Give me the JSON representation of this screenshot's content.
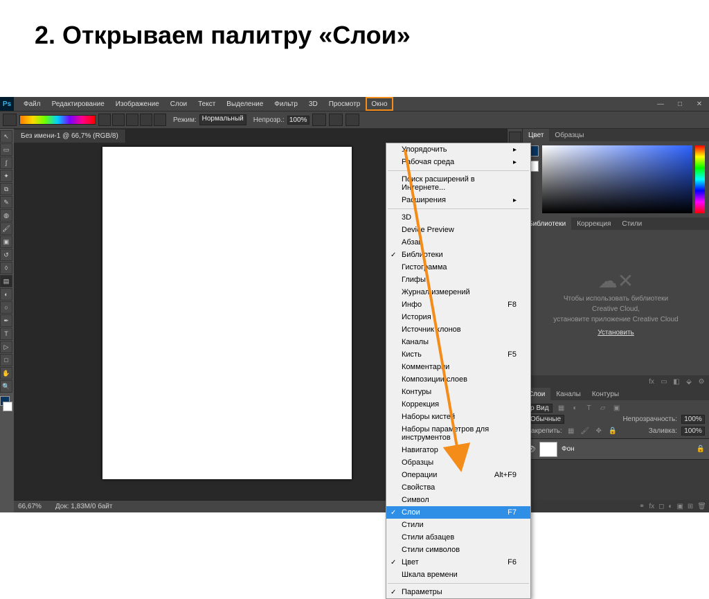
{
  "slide": {
    "title": "2. Открываем палитру «Слои»"
  },
  "menubar": {
    "logo": "Ps",
    "items": [
      "Файл",
      "Редактирование",
      "Изображение",
      "Слои",
      "Текст",
      "Выделение",
      "Фильтр",
      "3D",
      "Просмотр",
      "Окно"
    ]
  },
  "options": {
    "mode_label": "Режим:",
    "mode_value": "Нормальный",
    "opacity_label": "Непрозр.:",
    "opacity_value": "100%"
  },
  "doc_tab": "Без имени-1 @ 66,7% (RGB/8)",
  "status": {
    "zoom": "66,67%",
    "doc_info": "Док: 1,83M/0 байт"
  },
  "color_panel": {
    "tabs": [
      "Цвет",
      "Образцы"
    ]
  },
  "mid_tabs": [
    "Библиотеки",
    "Коррекция",
    "Стили"
  ],
  "cc": {
    "line1": "Чтобы использовать библиотеки",
    "line2": "Creative Cloud,",
    "line3": "установите приложение Creative Cloud",
    "install": "Установить"
  },
  "layers_panel": {
    "tabs": [
      "Слои",
      "Каналы",
      "Контуры"
    ],
    "kind": "ρ Вид",
    "blend": "Обычные",
    "opacity_label": "Непрозрачность:",
    "opacity": "100%",
    "lock_label": "Закрепить:",
    "fill_label": "Заливка:",
    "fill": "100%",
    "layer_name": "Фон"
  },
  "dropdown": {
    "items": [
      {
        "label": "Упорядочить",
        "sub": true
      },
      {
        "label": "Рабочая среда",
        "sub": true
      },
      {
        "sep": true
      },
      {
        "label": "Поиск расширений в Интернете..."
      },
      {
        "label": "Расширения",
        "sub": true
      },
      {
        "sep": true
      },
      {
        "label": "3D"
      },
      {
        "label": "Device Preview"
      },
      {
        "label": "Абзац"
      },
      {
        "label": "Библиотеки",
        "check": true
      },
      {
        "label": "Гистограмма"
      },
      {
        "label": "Глифы"
      },
      {
        "label": "Журнал измерений"
      },
      {
        "label": "Инфо",
        "shortcut": "F8"
      },
      {
        "label": "История"
      },
      {
        "label": "Источник клонов"
      },
      {
        "label": "Каналы"
      },
      {
        "label": "Кисть",
        "shortcut": "F5"
      },
      {
        "label": "Комментарии"
      },
      {
        "label": "Композиции слоев"
      },
      {
        "label": "Контуры"
      },
      {
        "label": "Коррекция"
      },
      {
        "label": "Наборы кистей"
      },
      {
        "label": "Наборы параметров для инструментов"
      },
      {
        "label": "Навигатор"
      },
      {
        "label": "Образцы"
      },
      {
        "label": "Операции",
        "shortcut": "Alt+F9"
      },
      {
        "label": "Свойства"
      },
      {
        "label": "Символ"
      },
      {
        "label": "Слои",
        "shortcut": "F7",
        "check": true,
        "selected": true
      },
      {
        "label": "Стили"
      },
      {
        "label": "Стили абзацев"
      },
      {
        "label": "Стили символов"
      },
      {
        "label": "Цвет",
        "shortcut": "F6",
        "check": true
      },
      {
        "label": "Шкала времени"
      },
      {
        "sep": true
      },
      {
        "label": "Параметры",
        "check": true
      }
    ]
  }
}
